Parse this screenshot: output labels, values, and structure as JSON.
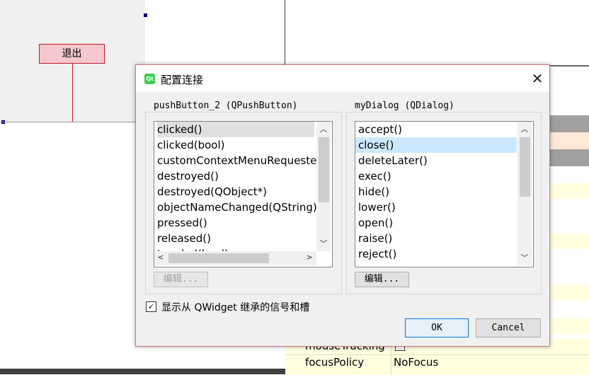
{
  "background": {
    "exit_button_label": "退出",
    "properties": [
      {
        "name": "mouseTracking",
        "value": ""
      },
      {
        "name": "focusPolicy",
        "value": "NoFocus"
      }
    ]
  },
  "dialog": {
    "title": "配置连接",
    "icon_text": "Qt",
    "left_group": {
      "title": "pushButton_2 (QPushButton)",
      "items": [
        "clicked()",
        "clicked(bool)",
        "customContextMenuRequeste",
        "destroyed()",
        "destroyed(QObject*)",
        "objectNameChanged(QString)",
        "pressed()",
        "released()",
        "toggled(bool)"
      ],
      "selected_index": 0,
      "edit_label": "编辑..."
    },
    "right_group": {
      "title": "myDialog (QDialog)",
      "items": [
        "accept()",
        "close()",
        "deleteLater()",
        "exec()",
        "hide()",
        "lower()",
        "open()",
        "raise()",
        "reject()"
      ],
      "selected_index": 1,
      "edit_label": "编辑..."
    },
    "inherit_checkbox": {
      "label": "显示从 QWidget 继承的信号和槽",
      "checked": true
    },
    "ok_label": "OK",
    "cancel_label": "Cancel"
  },
  "colors": {
    "accent_blue": "#0078d7",
    "selection_blue": "#cce8ff",
    "exit_button_border": "#c01c28",
    "property_yellow": "#ffffe0"
  }
}
